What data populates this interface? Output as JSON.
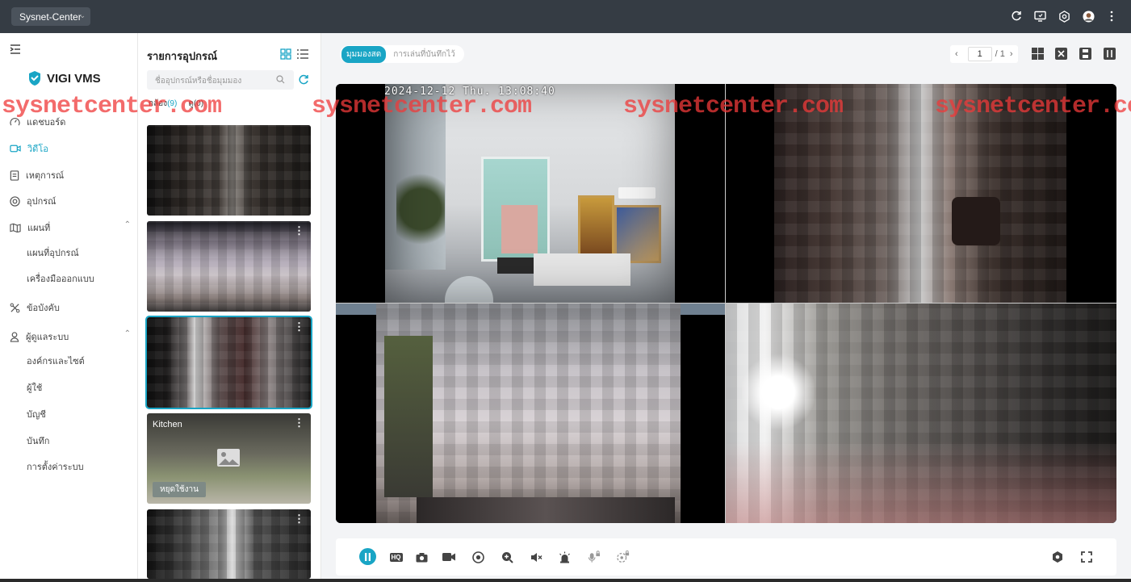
{
  "topbar": {
    "site_select": "Sysnet-Center",
    "icons": [
      "refresh-icon",
      "monitor-icon",
      "gear-icon",
      "avatar",
      "more-vertical-icon"
    ]
  },
  "sidebar": {
    "logo": "VIGI VMS",
    "items": [
      {
        "label": "แดชบอร์ด",
        "icon": "dashboard-icon"
      },
      {
        "label": "วิดีโอ",
        "icon": "video-icon",
        "active": true
      },
      {
        "label": "เหตุการณ์",
        "icon": "event-icon"
      },
      {
        "label": "อุปกรณ์",
        "icon": "device-icon"
      },
      {
        "label": "แผนที่",
        "icon": "map-icon",
        "expanded": true
      },
      {
        "label": "ข้อบังคับ",
        "icon": "rules-icon"
      },
      {
        "label": "ผู้ดูแลระบบ",
        "icon": "user-icon",
        "expanded": true
      }
    ],
    "map_sub": [
      "แผนที่อุปกรณ์",
      "เครื่องมือออกแบบ"
    ],
    "admin_sub": [
      "องค์กรและไซต์",
      "ผู้ใช้",
      "บัญชี",
      "บันทึก",
      "การตั้งค่าระบบ"
    ]
  },
  "device_panel": {
    "title": "รายการอุปกรณ์",
    "search_placeholder": "ชื่ออุปกรณ์หรือชื่อมุมมอง",
    "tab_cameras": "กล้อง",
    "tab_cameras_count": "(9)",
    "tab_views": "ดู",
    "tab_views_count": "(0)",
    "kitchen_name": "Kitchen",
    "kitchen_badge": "หยุดใช้งาน"
  },
  "main": {
    "tab_live": "มุมมองสด",
    "tab_playback": "การเล่นที่บันทึกไว้",
    "page_current": "1",
    "page_total": "/ 1",
    "timestamp": "2024-12-12 Thu. 13:08:40",
    "hq_label": "HQ"
  },
  "watermark": "sysnetcenter.com",
  "colors": {
    "accent": "#19a5c5",
    "topbar": "#353c44",
    "watermark": "#ef3a3a"
  }
}
